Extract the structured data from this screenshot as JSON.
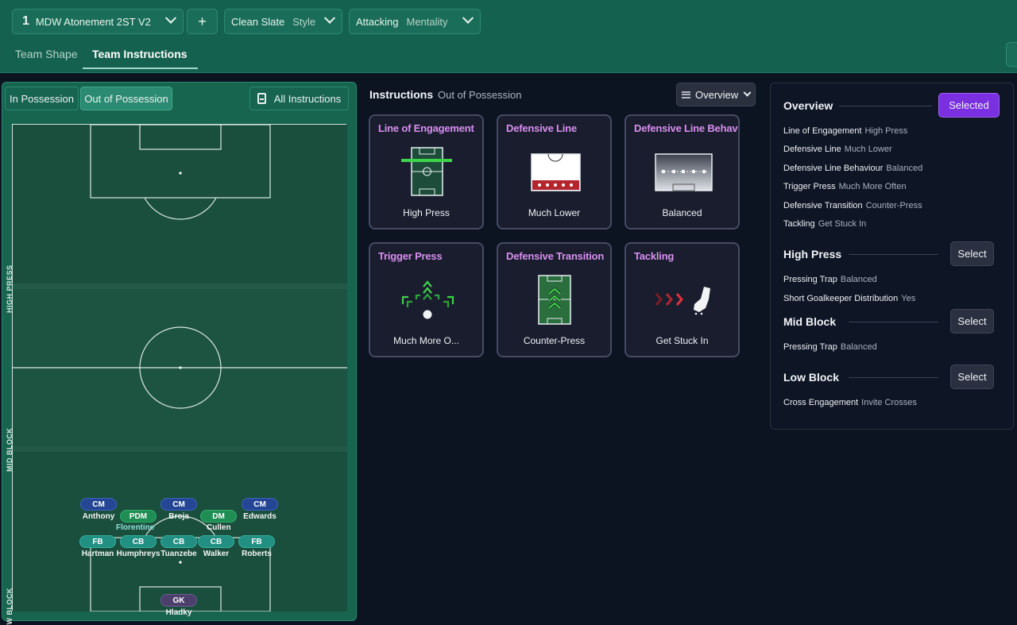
{
  "header": {
    "tactic_number": "1",
    "tactic_name": "MDW Atonement 2ST V2",
    "add_label": "+",
    "style_value": "Clean Slate",
    "style_label": "Style",
    "mentality_value": "Attacking",
    "mentality_label": "Mentality",
    "tabs": [
      {
        "label": "Team Shape"
      },
      {
        "label": "Team Instructions"
      }
    ]
  },
  "pitch_panel": {
    "in_possession": "In Possession",
    "out_of_possession": "Out of Possession",
    "all_instructions": "All Instructions",
    "zones": [
      "HIGH PRESS",
      "MID BLOCK",
      "LOW BLOCK"
    ],
    "players": [
      {
        "role": "CM",
        "name": "Anthony"
      },
      {
        "role": "PDM",
        "name": ""
      },
      {
        "role": "CM",
        "name": "Broja"
      },
      {
        "role": "DM",
        "name": ""
      },
      {
        "role": "CM",
        "name": "Edwards"
      },
      {
        "role": "FB",
        "name": "Hartman"
      },
      {
        "role": "CB",
        "name": "Humphreys"
      },
      {
        "role": "CB",
        "name": "Tuanzebe"
      },
      {
        "role": "CB",
        "name": "Walker"
      },
      {
        "role": "FB",
        "name": "Roberts"
      },
      {
        "role": "GK",
        "name": "Hladky"
      }
    ],
    "extra_names": {
      "florentine": "Florentine",
      "cullen": "Cullen"
    }
  },
  "instructions": {
    "title": "Instructions",
    "subtitle": "Out of Possession",
    "view_dropdown": "Overview",
    "cards": [
      {
        "title": "Line of Engagement",
        "value": "High Press"
      },
      {
        "title": "Defensive Line",
        "value": "Much Lower"
      },
      {
        "title": "Defensive Line Behaviour",
        "value": "Balanced"
      },
      {
        "title": "Trigger Press",
        "value": "Much More O..."
      },
      {
        "title": "Defensive Transition",
        "value": "Counter-Press"
      },
      {
        "title": "Tackling",
        "value": "Get Stuck In"
      }
    ]
  },
  "overview": {
    "title": "Overview",
    "selected_label": "Selected",
    "rows": [
      {
        "label": "Line of Engagement",
        "value": "High Press"
      },
      {
        "label": "Defensive Line",
        "value": "Much Lower"
      },
      {
        "label": "Defensive Line Behaviour",
        "value": "Balanced"
      },
      {
        "label": "Trigger Press",
        "value": "Much More Often"
      },
      {
        "label": "Defensive Transition",
        "value": "Counter-Press"
      },
      {
        "label": "Tackling",
        "value": "Get Stuck In"
      }
    ],
    "high_press": {
      "title": "High Press",
      "button": "Select",
      "rows": [
        {
          "label": "Pressing Trap",
          "value": "Balanced"
        },
        {
          "label": "Short Goalkeeper Distribution",
          "value": "Yes"
        }
      ]
    },
    "mid_block": {
      "title": "Mid Block",
      "button": "Select",
      "rows": [
        {
          "label": "Pressing Trap",
          "value": "Balanced"
        }
      ]
    },
    "low_block": {
      "title": "Low Block",
      "button": "Select",
      "rows": [
        {
          "label": "Cross Engagement",
          "value": "Invite Crosses"
        }
      ]
    }
  },
  "colors": {
    "header_bg": "#15614f",
    "pitch_bg": "#1a4d3b",
    "accent_purple": "#7a2fe0",
    "card_title": "#d98ff0"
  }
}
